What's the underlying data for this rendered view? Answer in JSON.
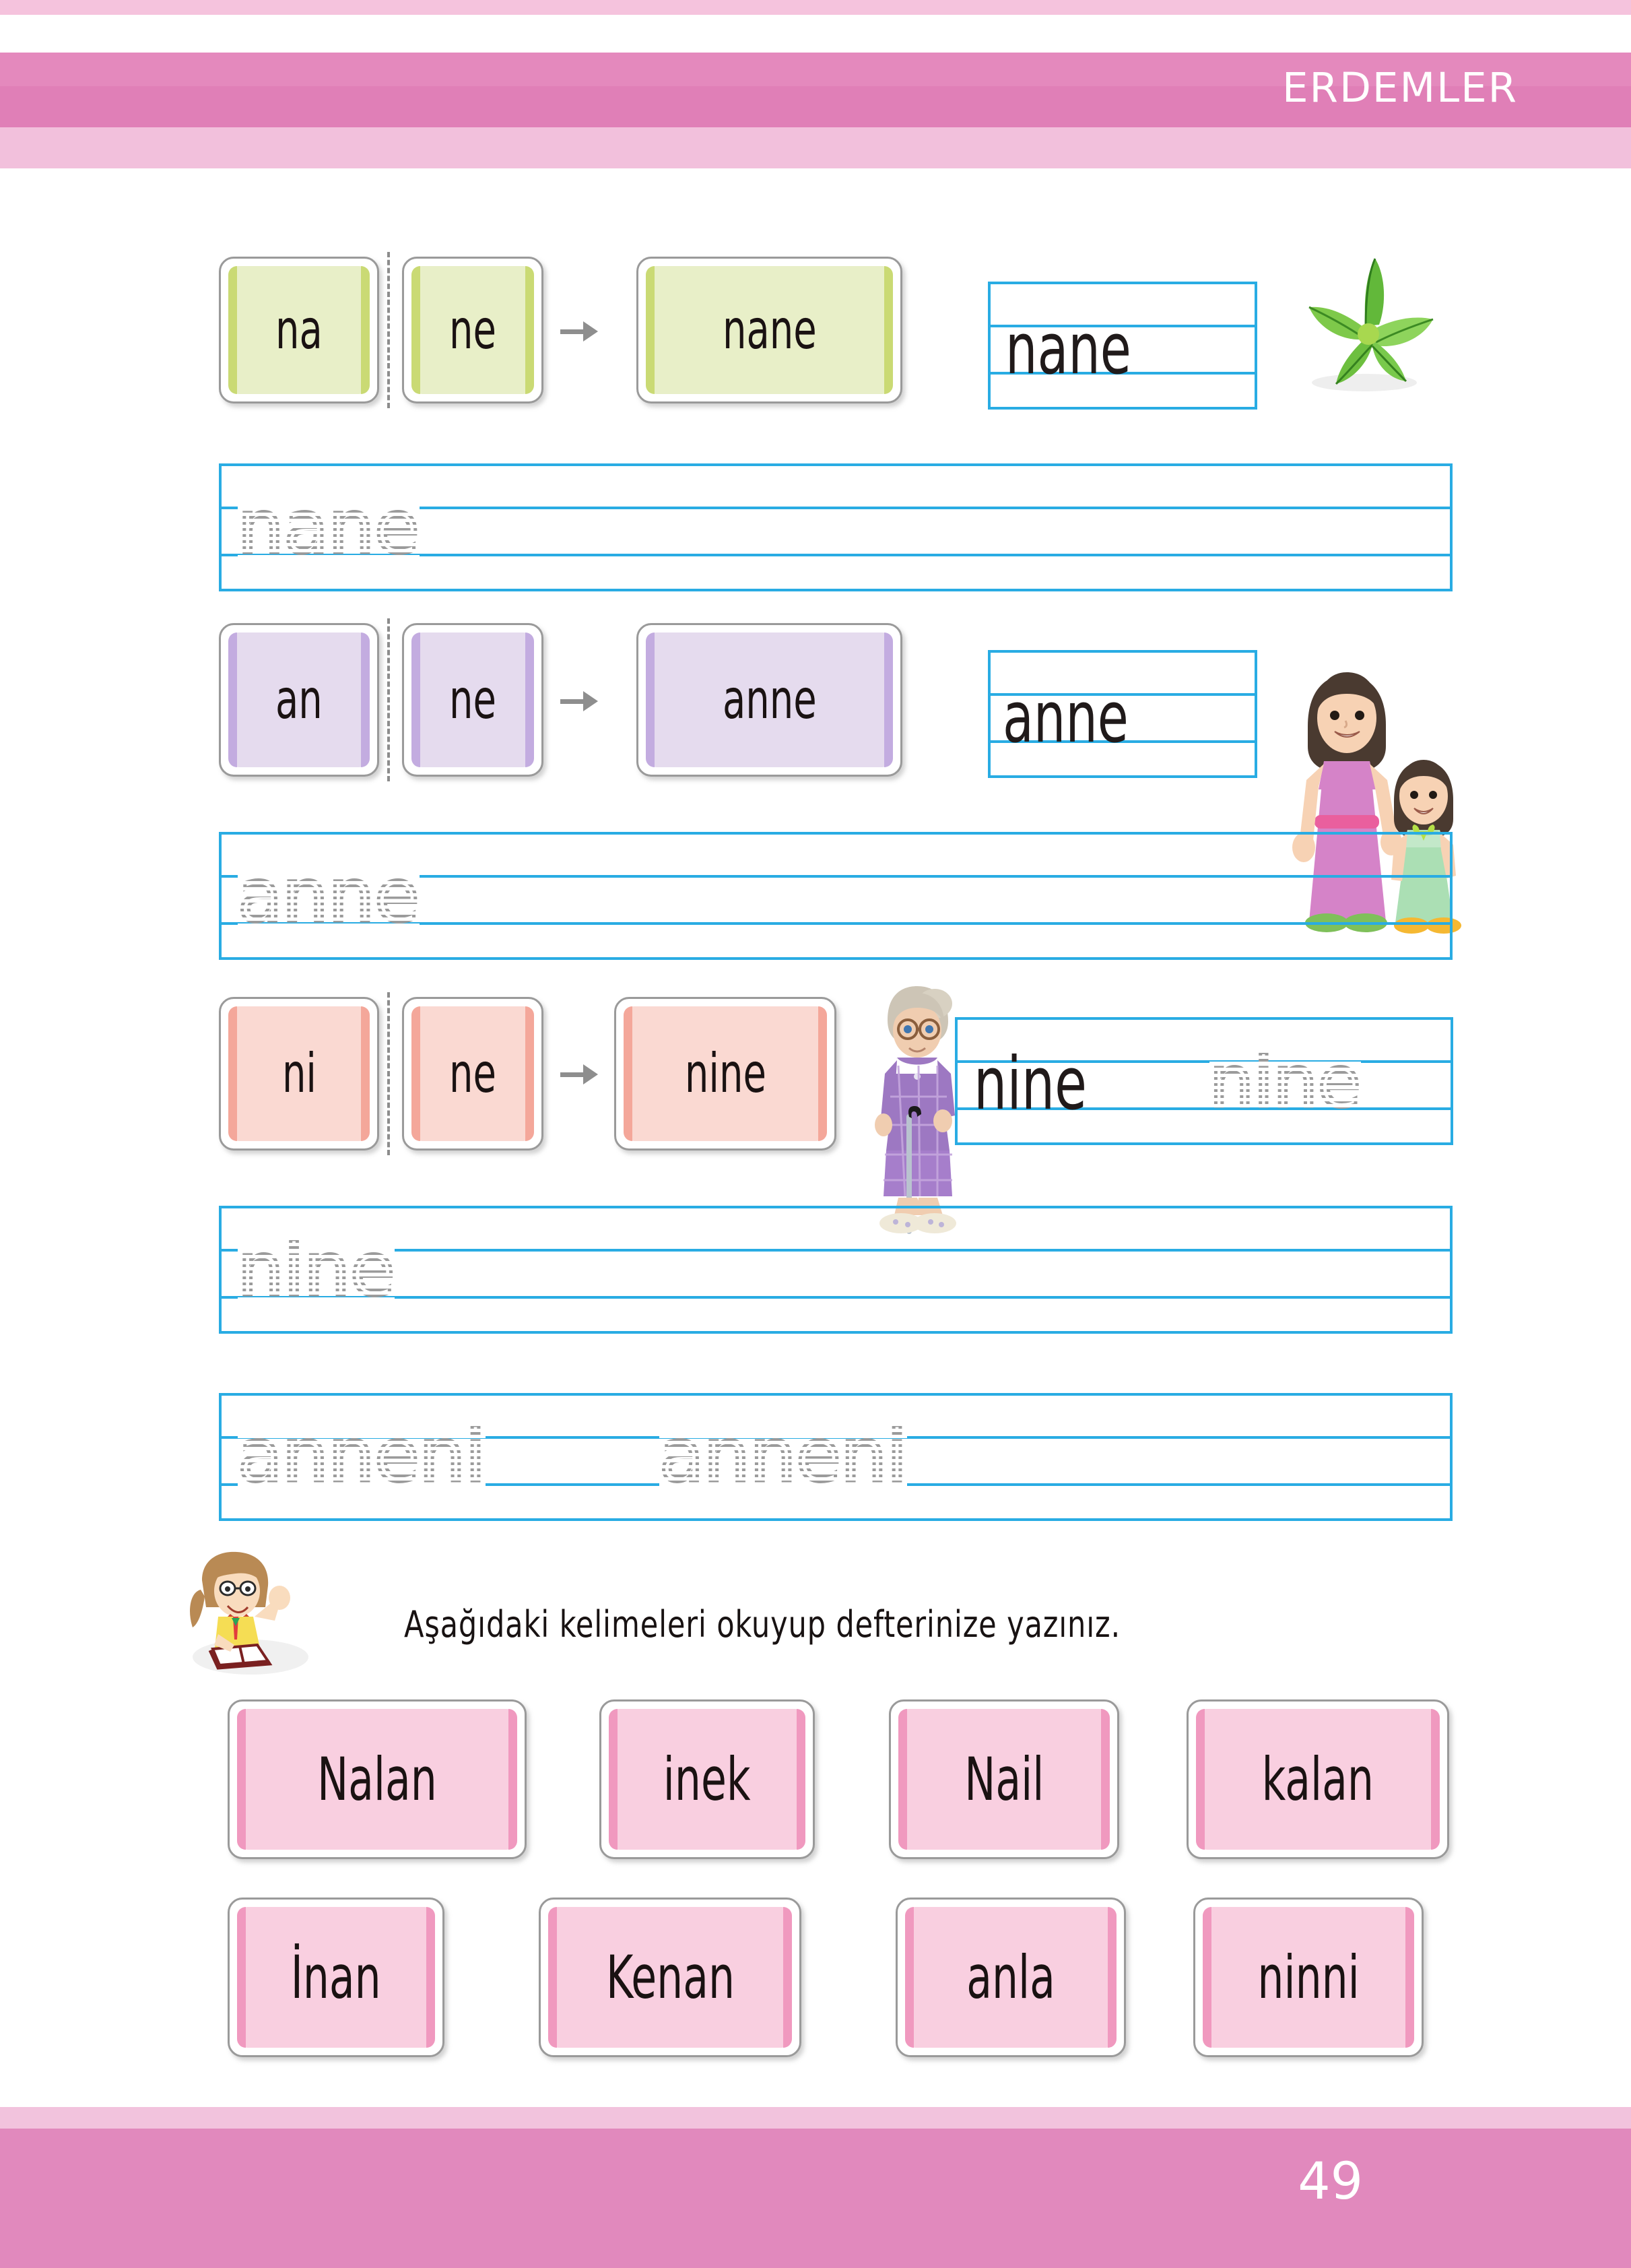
{
  "header": {
    "title": "ERDEMLER",
    "band_color": "#e489bd",
    "accent_light": "#f2c0dc"
  },
  "footer": {
    "page_number": "49",
    "band_color": "#e189bd"
  },
  "colors": {
    "rule_blue": "#29ace3",
    "dotted_gray": "#9b9b9b",
    "card_border": "#9a9a9a",
    "green_fill": "#e8efc8",
    "green_edge": "#cada74",
    "purple_fill": "#e5dbee",
    "purple_edge": "#c3ace0",
    "salmon_fill": "#fad9d2",
    "salmon_edge": "#f4a79a",
    "pink_fill": "#f9cfe0",
    "pink_edge": "#f099bf"
  },
  "word_builders": [
    {
      "id": "nane",
      "color": "green",
      "syllable_1": "na",
      "syllable_2": "ne",
      "result": "nane",
      "arrow": "arrow-right-icon",
      "ruled_word": "nane",
      "picture": "mint-leaves-image",
      "trace_line_word": "nane"
    },
    {
      "id": "anne",
      "color": "purple",
      "syllable_1": "an",
      "syllable_2": "ne",
      "result": "anne",
      "arrow": "arrow-right-icon",
      "ruled_word": "anne",
      "picture": "mother-and-daughter-image",
      "trace_line_word": "anne"
    },
    {
      "id": "nine",
      "color": "salmon",
      "syllable_1": "ni",
      "syllable_2": "ne",
      "result": "nine",
      "arrow": "arrow-right-icon",
      "ruled_word": "nine",
      "ruled_word_dotted": "nine",
      "picture": "grandmother-image",
      "trace_line_word": "nine"
    }
  ],
  "extra_trace_line": {
    "word_1": "anneni",
    "word_2": "anneni"
  },
  "instruction": {
    "icon": "girl-reading-book-image",
    "text": "Aşağıdaki kelimeleri okuyup defterinize yazınız."
  },
  "word_bank": {
    "row_1": [
      "Nalan",
      "inek",
      "Nail",
      "kalan"
    ],
    "row_2": [
      "İnan",
      "Kenan",
      "anla",
      "ninni"
    ]
  }
}
